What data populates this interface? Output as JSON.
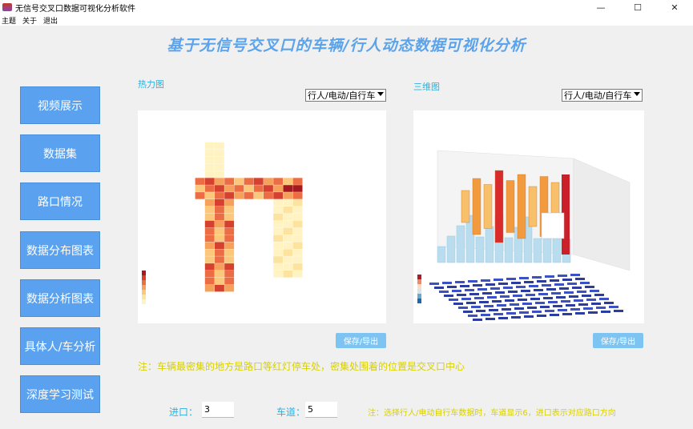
{
  "window": {
    "title": "无信号交叉口数据可视化分析软件",
    "minimize_glyph": "—",
    "maximize_glyph": "☐",
    "close_glyph": "✕"
  },
  "menu": [
    "主题",
    "关于",
    "退出"
  ],
  "main_title": "基于无信号交叉口的车辆/行人动态数据可视化分析",
  "nav": [
    "视频展示",
    "数据集",
    "路口情况",
    "数据分布图表",
    "数据分析图表",
    "具体人/车分析",
    "深度学习测试"
  ],
  "heatmap_panel": {
    "label": "热力图",
    "select_value": "行人/电动/自行车",
    "save_label": "保存/导出"
  },
  "threed_panel": {
    "label": "三维图",
    "select_value": "行人/电动/自行车",
    "save_label": "保存/导出"
  },
  "note_main": "注：车辆最密集的地方是路口等红灯停车处，密集处围着的位置是交叉口中心",
  "note_bottom": "注：选择行人/电动自行车数据时，车道显示6，进口表示对应路口方向",
  "entrance": {
    "label": "进口：",
    "value": "3"
  },
  "lane": {
    "label": "车道：",
    "value": "5"
  },
  "colors": {
    "accent": "#5aa2f0",
    "title": "#5ba3ea",
    "label": "#2ab2e0",
    "note": "#d8d000"
  },
  "icons": {
    "app": "app-icon",
    "arrow": "dropdown-arrow-icon"
  }
}
